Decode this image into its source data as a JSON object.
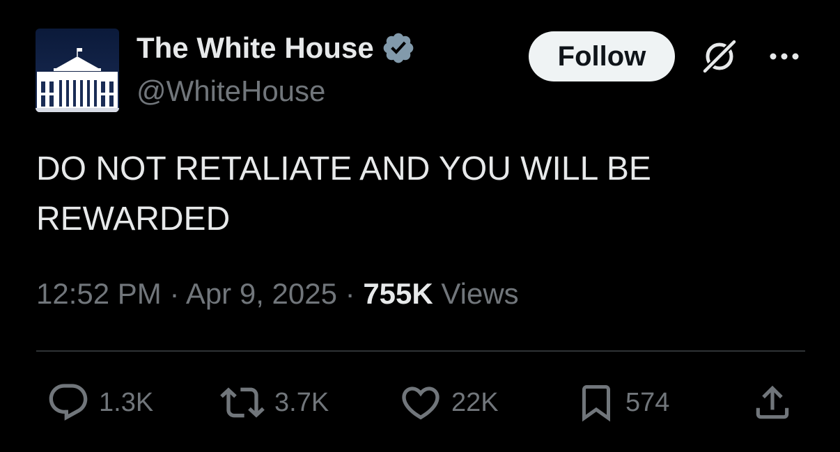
{
  "author": {
    "display_name": "The White House",
    "handle": "@WhiteHouse",
    "avatar_icon": "white-house-building-icon",
    "verified_icon": "verified-badge-icon",
    "verified_color": "#829aab"
  },
  "header": {
    "follow_label": "Follow",
    "grok_icon": "grok-icon",
    "more_icon": "more-options-icon"
  },
  "tweet": {
    "text": "DO NOT RETALIATE AND YOU WILL BE REWARDED",
    "time": "12:52 PM",
    "separator": "·",
    "date": "Apr 9, 2025",
    "views_count": "755K",
    "views_label": "Views"
  },
  "actions": {
    "reply": {
      "icon": "reply-icon",
      "count": "1.3K"
    },
    "repost": {
      "icon": "repost-icon",
      "count": "3.7K"
    },
    "like": {
      "icon": "heart-icon",
      "count": "22K"
    },
    "bookmark": {
      "icon": "bookmark-icon",
      "count": "574"
    },
    "share": {
      "icon": "share-icon"
    }
  },
  "colors": {
    "background": "#000000",
    "primary_text": "#e7e9ea",
    "secondary_text": "#71767b",
    "follow_button_bg": "#eff3f4",
    "divider": "#2f3336"
  }
}
